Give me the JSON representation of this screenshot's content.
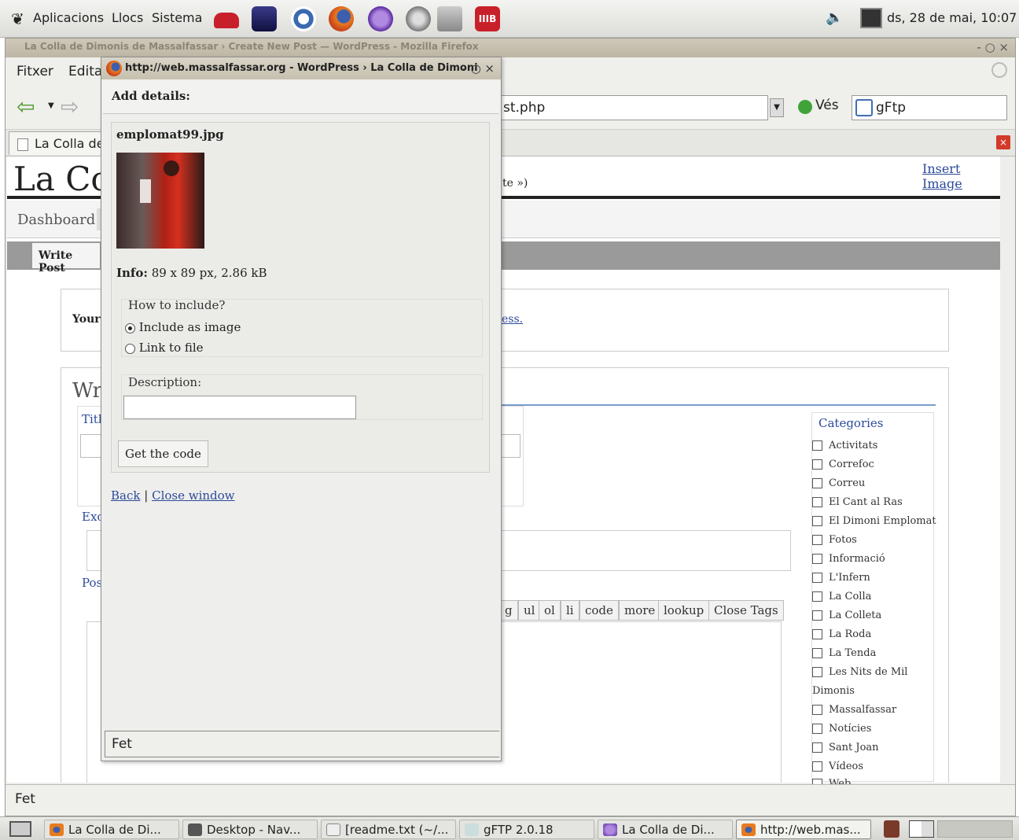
{
  "top_panel": {
    "menus": [
      "Aplicacions",
      "Llocs",
      "Sistema"
    ],
    "clock": "ds, 28 de mai, 10:07",
    "launchers": [
      "phone-icon",
      "terminal-icon",
      "help-icon",
      "firefox-icon",
      "nvu-icon",
      "gftp-icon",
      "search-icon",
      "mib-icon"
    ]
  },
  "firefox": {
    "title": "La Colla de Dimonis de Massalfassar › Create New Post — WordPress - Mozilla Firefox",
    "menu": [
      "Fitxer",
      "Edita"
    ],
    "url_fragment": "st.php",
    "go_label": "Vés",
    "search_value": "gFtp",
    "tab_label": "La Colla de",
    "status_text": "Fet"
  },
  "wordpress": {
    "blog_title": "La Coll",
    "nav_dashboard": "Dashboard",
    "subnav_write_post": "Write Post",
    "notice_prefix": "Your",
    "notice_suffix": "ess.",
    "view_site_fragment": "te »)",
    "insert_image": "Insert Image",
    "write_heading": "Wr",
    "title_label": "Titl",
    "excerpt_label": "Exc",
    "post_label": "Pos",
    "quicktags": [
      "g",
      "ul",
      "ol",
      "li",
      "code",
      "more",
      "lookup",
      "Close Tags"
    ],
    "categories_heading": "Categories",
    "categories": [
      "Activitats",
      "Correfoc",
      "Correu",
      "El Cant al Ras",
      "El Dimoni Emplomat",
      "Fotos",
      "Informació",
      "L'Infern",
      "La Colla",
      "La Colleta",
      "La Roda",
      "La Tenda",
      "Les Nits de Mil",
      "Dimonis",
      "Massalfassar",
      "Notícies",
      "Sant Joan",
      "Vídeos",
      "Web"
    ]
  },
  "popup": {
    "title": "http://web.massalfassar.org - WordPress › La Colla de Dimoni",
    "add_details": "Add details:",
    "filename": "emplomat99.jpg",
    "info_label": "Info:",
    "info_value": "89 x 89 px, 2.86 kB",
    "how_to_include": "How to include?",
    "option_image": "Include as image",
    "option_link": "Link to file",
    "description_label": "Description:",
    "description_value": "",
    "get_code": "Get the code",
    "back": "Back",
    "separator": "|",
    "close_window": "Close window",
    "status_text": "Fet"
  },
  "taskbar": {
    "tasks": [
      "La Colla de Di...",
      "Desktop - Nav...",
      "[readme.txt (~/...",
      "gFTP 2.0.18",
      "La Colla de Di...",
      "http://web.mas..."
    ]
  },
  "colors": {
    "wp_link": "#2c4a9a",
    "wp_bar": "#9a9a9a",
    "accent_blue": "#3f6fb2"
  }
}
